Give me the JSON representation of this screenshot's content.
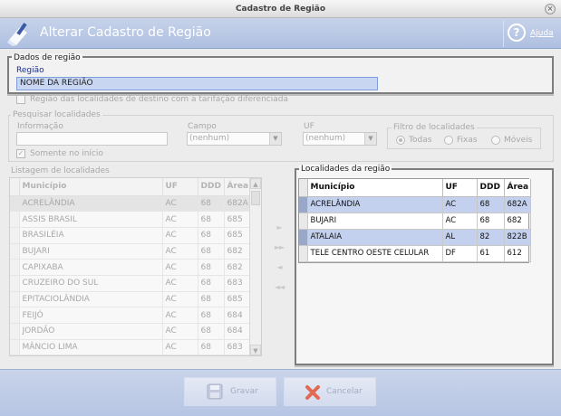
{
  "window": {
    "title": "Cadastro de Região",
    "close_glyph": "×"
  },
  "header": {
    "title": "Alterar Cadastro de Região",
    "help_label": "Ajuda",
    "help_glyph": "?"
  },
  "dados": {
    "legend": "Dados de região",
    "regiao_label": "Região",
    "regiao_value": "NOME DA REGIÃO"
  },
  "tarifacao_label": "Região das localidades de destino com a tarifação diferenciada",
  "pesquisar": {
    "legend": "Pesquisar localidades",
    "informacao_label": "Informação",
    "informacao_value": "",
    "campo_label": "Campo",
    "campo_value": "(nenhum)",
    "uf_label": "UF",
    "uf_value": "(nenhum)",
    "somente_inicio_label": "Somente no início",
    "filtro": {
      "legend": "Filtro de localidades",
      "todas": "Todas",
      "fixas": "Fixas",
      "moveis": "Móveis"
    }
  },
  "listagem": {
    "legend": "Listagem de localidades",
    "columns": [
      "Município",
      "UF",
      "DDD",
      "Área"
    ],
    "rows": [
      [
        "ACRELÂNDIA",
        "AC",
        "68",
        "682A"
      ],
      [
        "ASSIS BRASIL",
        "AC",
        "68",
        "685"
      ],
      [
        "BRASILÉIA",
        "AC",
        "68",
        "685"
      ],
      [
        "BUJARI",
        "AC",
        "68",
        "682"
      ],
      [
        "CAPIXABA",
        "AC",
        "68",
        "682"
      ],
      [
        "CRUZEIRO DO SUL",
        "AC",
        "68",
        "683"
      ],
      [
        "EPITACIOLÂNDIA",
        "AC",
        "68",
        "685"
      ],
      [
        "FEIJÓ",
        "AC",
        "68",
        "684"
      ],
      [
        "JORDÃO",
        "AC",
        "68",
        "684"
      ],
      [
        "MÂNCIO LIMA",
        "AC",
        "68",
        "683"
      ]
    ]
  },
  "move_buttons": {
    "add": "►",
    "add_all": "►►",
    "remove": "◄",
    "remove_all": "◄◄"
  },
  "localidades": {
    "legend": "Localidades da região",
    "columns": [
      "Município",
      "UF",
      "DDD",
      "Área"
    ],
    "rows": [
      [
        "ACRELÂNDIA",
        "AC",
        "68",
        "682A"
      ],
      [
        "BUJARI",
        "AC",
        "68",
        "682"
      ],
      [
        "ATALAIA",
        "AL",
        "82",
        "822B"
      ],
      [
        "TELE CENTRO OESTE CELULAR",
        "DF",
        "61",
        "612"
      ]
    ]
  },
  "footer": {
    "gravar_label": "Gravar",
    "cancelar_label": "Cancelar"
  },
  "colors": {
    "header": "#b4c4e4",
    "highlight": "#c3d0ee",
    "cancel_x": "#e06a55"
  },
  "icons": {
    "header": "eraser-pencil-icon",
    "help": "help-circle-icon",
    "gravar": "floppy-disk-icon",
    "cancelar": "red-x-icon"
  }
}
